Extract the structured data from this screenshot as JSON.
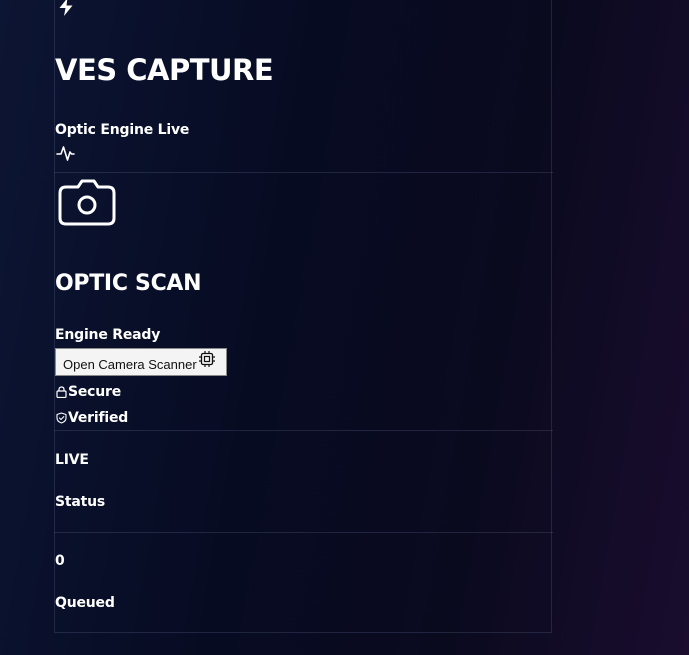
{
  "header": {
    "title": "VES CAPTURE",
    "engine_status": "Optic Engine Live",
    "bolt_icon": "bolt-icon",
    "pulse_icon": "activity-icon"
  },
  "scanner": {
    "camera_icon": "camera-icon",
    "title": "OPTIC SCAN",
    "status": "Engine Ready",
    "button_label": "Open Camera Scanner",
    "button_icon": "cpu-icon",
    "badges": [
      {
        "label": "Secure",
        "icon": "lock-icon"
      },
      {
        "label": "Verified",
        "icon": "shield-icon"
      }
    ]
  },
  "stats": [
    {
      "value": "LIVE",
      "label": "Status"
    },
    {
      "value": "0",
      "label": "Queued"
    }
  ]
}
